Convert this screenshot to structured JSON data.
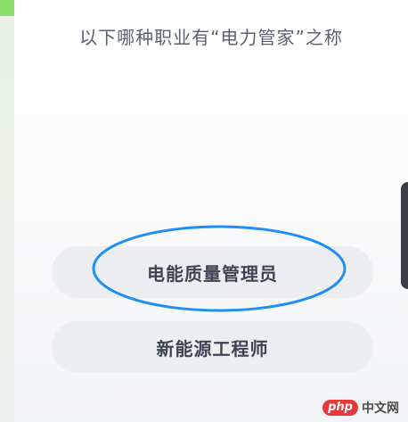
{
  "question": {
    "text": "以下哪种职业有“电力管家”之称"
  },
  "options": [
    {
      "label": "电能质量管理员",
      "highlighted": true
    },
    {
      "label": "新能源工程师",
      "highlighted": false
    }
  ],
  "colors": {
    "highlight": "#1e90f5",
    "sidebar_accent": "#8fe06a",
    "option_bg": "#eceef1",
    "question_text": "#5b6172",
    "option_text": "#3e4452"
  },
  "watermark": {
    "logo": "php",
    "text": "中文网"
  }
}
